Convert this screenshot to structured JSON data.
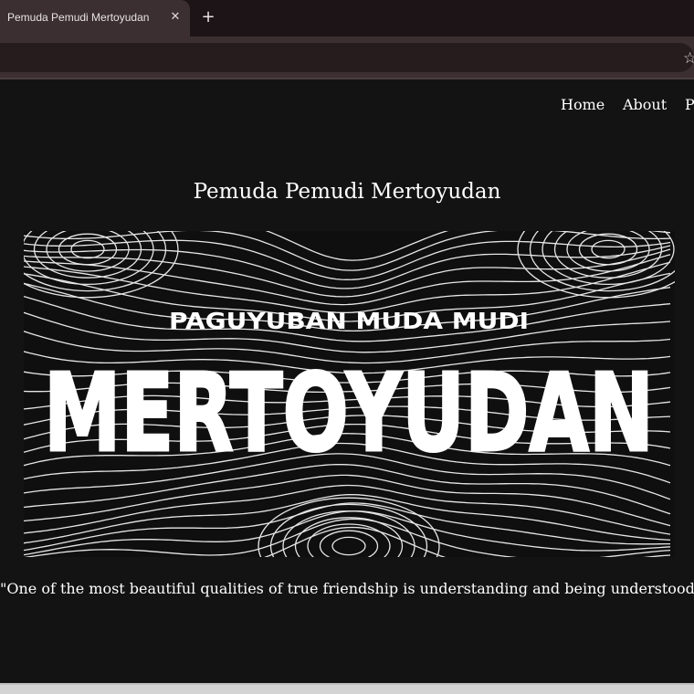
{
  "browser": {
    "tab_title": "Pemuda Pemudi Mertoyudan",
    "tab_close_glyph": "✕",
    "new_tab_glyph": "+",
    "bookmark_glyph": "☆"
  },
  "nav": {
    "items": [
      {
        "label": "Home"
      },
      {
        "label": "About"
      },
      {
        "label": "P"
      }
    ]
  },
  "page": {
    "title": "Pemuda Pemudi Mertoyudan",
    "quote": "\"One of the most beautiful qualities of true friendship is understanding and being understood.\""
  },
  "banner": {
    "subtitle": "PAGUYUBAN MUDA MUDI",
    "headline": "MERTOYUDAN",
    "background_color": "#0f0f0f",
    "line_color": "#e6e6e6"
  },
  "colors": {
    "page_bg": "#131313",
    "text": "#ffffff",
    "tab_bg": "#3b2f31",
    "tabstrip_bg": "#1c1416"
  }
}
